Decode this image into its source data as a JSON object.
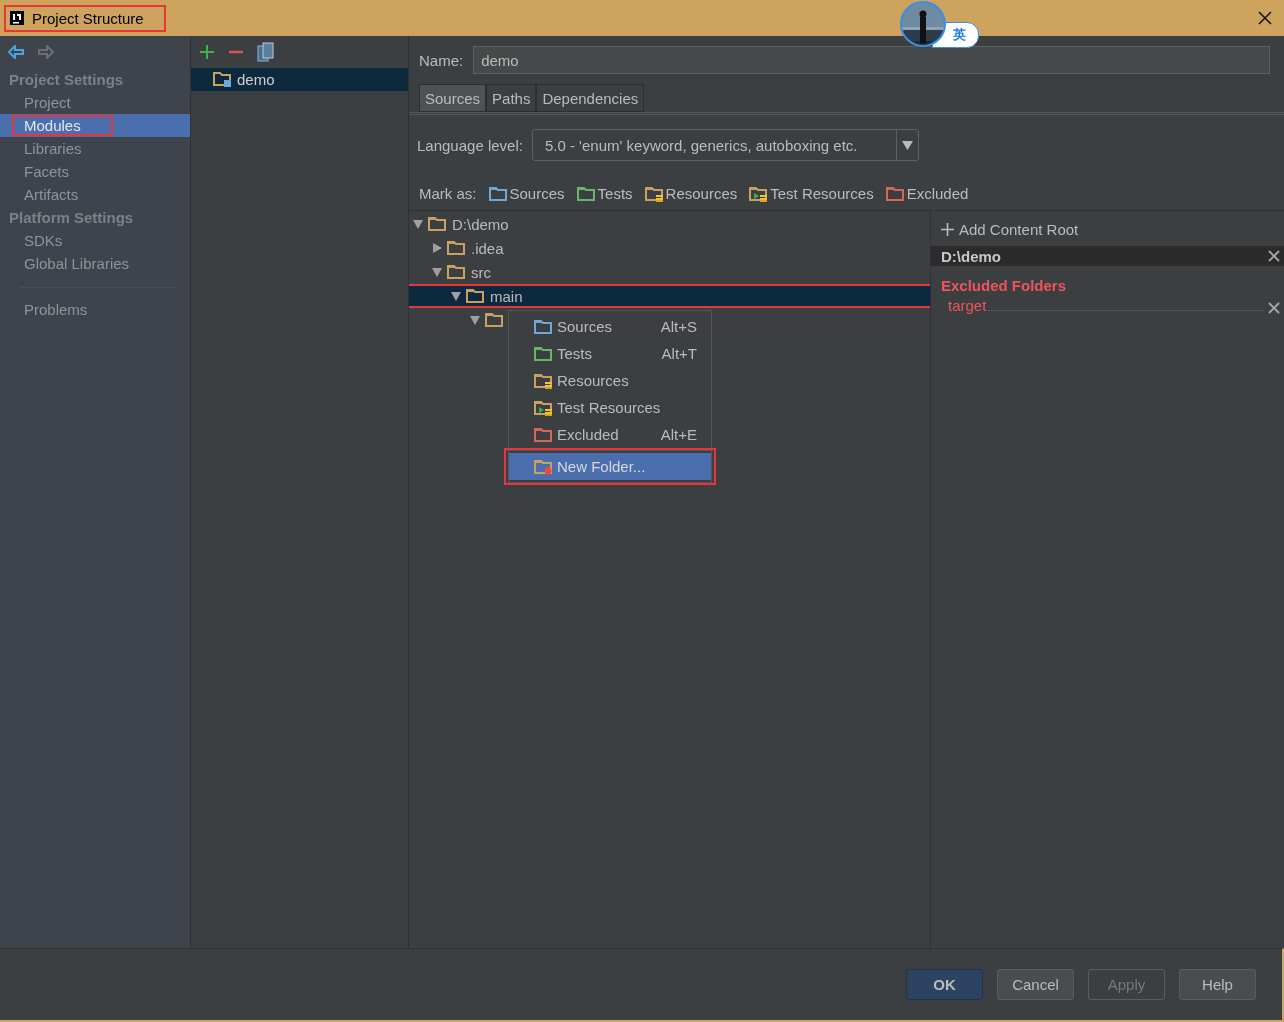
{
  "window": {
    "title": "Project Structure",
    "highlighted": true
  },
  "ime_badge": {
    "label": "英"
  },
  "sidebar": {
    "sections": [
      {
        "heading": "Project Settings",
        "items": [
          {
            "label": "Project",
            "selected": false,
            "highlighted": false
          },
          {
            "label": "Modules",
            "selected": true,
            "highlighted": true
          },
          {
            "label": "Libraries",
            "selected": false,
            "highlighted": false
          },
          {
            "label": "Facets",
            "selected": false,
            "highlighted": false
          },
          {
            "label": "Artifacts",
            "selected": false,
            "highlighted": false
          }
        ]
      },
      {
        "heading": "Platform Settings",
        "items": [
          {
            "label": "SDKs",
            "selected": false,
            "highlighted": false
          },
          {
            "label": "Global Libraries",
            "selected": false,
            "highlighted": false
          }
        ]
      }
    ],
    "extra_items": [
      {
        "label": "Problems",
        "selected": false,
        "highlighted": false
      }
    ]
  },
  "modules": {
    "items": [
      {
        "label": "demo",
        "selected": true
      }
    ]
  },
  "name_field": {
    "label": "Name:",
    "value": "demo"
  },
  "tabs": [
    {
      "label": "Sources",
      "selected": true
    },
    {
      "label": "Paths",
      "selected": false
    },
    {
      "label": "Dependencies",
      "selected": false
    }
  ],
  "language_level": {
    "label": "Language level:",
    "value": "5.0 - 'enum' keyword, generics, autoboxing etc."
  },
  "mark_as": {
    "label": "Mark as:",
    "options": [
      {
        "kind": "sources",
        "label": "Sources"
      },
      {
        "kind": "tests",
        "label": "Tests"
      },
      {
        "kind": "resources",
        "label": "Resources"
      },
      {
        "kind": "test_resources",
        "label": "Test Resources"
      },
      {
        "kind": "excluded",
        "label": "Excluded"
      }
    ]
  },
  "tree": {
    "nodes": [
      {
        "label": "D:\\demo",
        "expanded": true,
        "selected": false,
        "highlighted": false,
        "children": [
          {
            "label": ".idea",
            "expanded": false,
            "selected": false,
            "highlighted": false
          },
          {
            "label": "src",
            "expanded": true,
            "selected": false,
            "highlighted": false,
            "children": [
              {
                "label": "main",
                "expanded": true,
                "selected": true,
                "highlighted": true,
                "children": [
                  {
                    "expanded": true,
                    "selected": false,
                    "highlighted": false
                  }
                ]
              }
            ]
          }
        ]
      }
    ]
  },
  "context_menu": {
    "items": [
      {
        "kind": "sources",
        "label": "Sources",
        "shortcut": "Alt+S",
        "selected": false,
        "highlighted": false
      },
      {
        "kind": "tests",
        "label": "Tests",
        "shortcut": "Alt+T",
        "selected": false,
        "highlighted": false
      },
      {
        "kind": "resources",
        "label": "Resources",
        "selected": false,
        "highlighted": false
      },
      {
        "kind": "test_resources",
        "label": "Test Resources",
        "selected": false,
        "highlighted": false
      },
      {
        "kind": "excluded",
        "label": "Excluded",
        "shortcut": "Alt+E",
        "selected": false,
        "highlighted": false
      },
      {
        "kind": "new_folder",
        "label": "New Folder...",
        "selected": true,
        "highlighted": true
      }
    ]
  },
  "content_root": {
    "add_label": "Add Content Root",
    "root": "D:\\demo",
    "excluded_heading": "Excluded Folders",
    "excluded": [
      "target"
    ]
  },
  "buttons": [
    {
      "label": "OK",
      "primary": true,
      "disabled": false
    },
    {
      "label": "Cancel",
      "primary": false,
      "disabled": false
    },
    {
      "label": "Apply",
      "primary": false,
      "disabled": true
    },
    {
      "label": "Help",
      "primary": false,
      "disabled": false
    }
  ]
}
